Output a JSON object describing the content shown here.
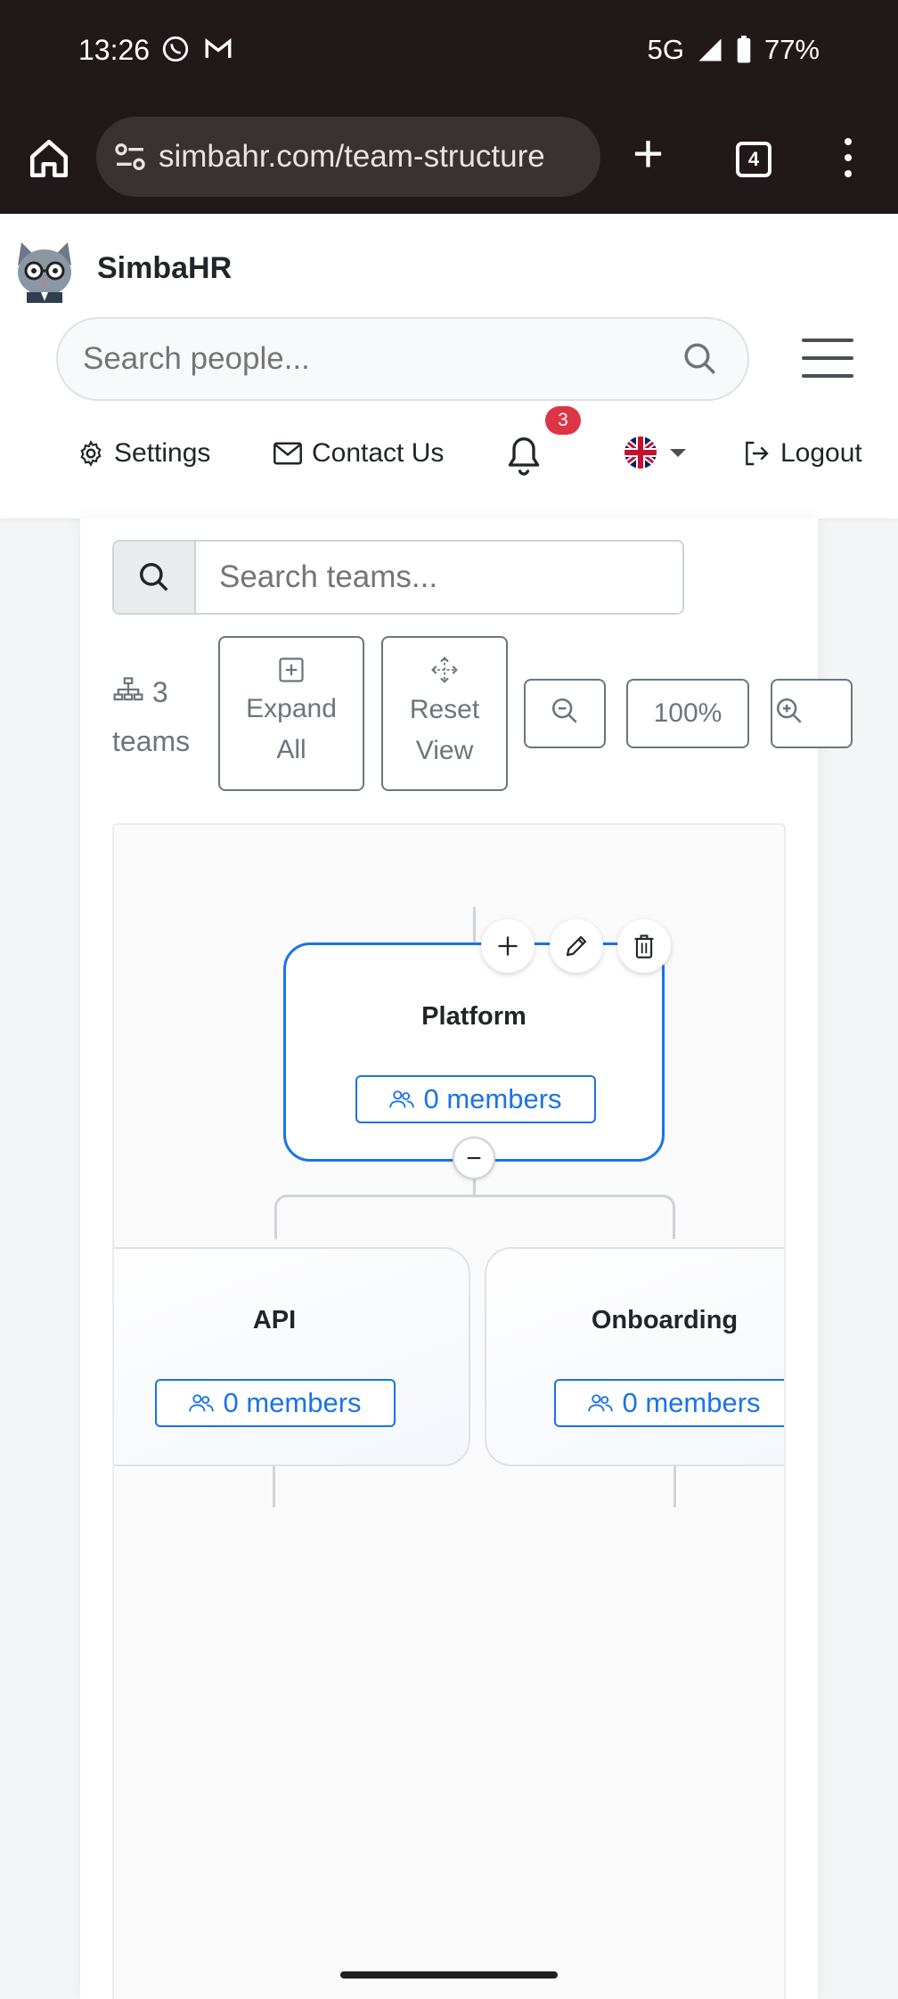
{
  "status_bar": {
    "time": "13:26",
    "network": "5G",
    "battery": "77%"
  },
  "browser": {
    "url": "simbahr.com/team-structure",
    "tab_count": "4"
  },
  "header": {
    "brand": "SimbaHR",
    "search_placeholder": "Search people...",
    "nav": {
      "settings": "Settings",
      "contact": "Contact Us",
      "notifications": "3",
      "logout": "Logout"
    }
  },
  "toolbar": {
    "search_placeholder": "Search teams...",
    "team_count": "3",
    "team_count_label": "teams",
    "expand_label": [
      "Expand",
      "All"
    ],
    "reset_label": [
      "Reset",
      "View"
    ],
    "zoom_level": "100%"
  },
  "tree": {
    "root": {
      "name": "Platform",
      "members": "0 members"
    },
    "children": [
      {
        "name": "API",
        "members": "0 members"
      },
      {
        "name": "Onboarding",
        "members": "0 members"
      }
    ]
  },
  "colors": {
    "primary": "#1a73e8",
    "badge": "#dc3545",
    "chrome": "#201819"
  }
}
